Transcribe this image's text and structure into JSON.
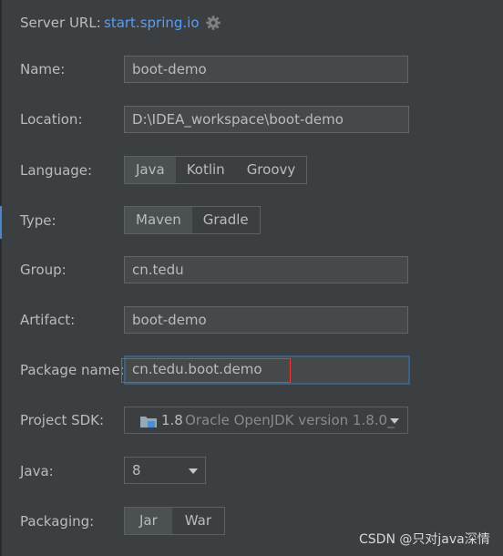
{
  "server": {
    "label": "Server URL:",
    "url": "start.spring.io",
    "settings_icon": "gear-icon"
  },
  "name": {
    "label": "Name:",
    "value": "boot-demo"
  },
  "location": {
    "label": "Location:",
    "value": "D:\\IDEA_workspace\\boot-demo"
  },
  "language": {
    "label": "Language:",
    "options": [
      "Java",
      "Kotlin",
      "Groovy"
    ],
    "selected": "Java"
  },
  "type": {
    "label": "Type:",
    "options": [
      "Maven",
      "Gradle"
    ],
    "selected": "Maven"
  },
  "group": {
    "label": "Group:",
    "value": "cn.tedu"
  },
  "artifact": {
    "label": "Artifact:",
    "value": "boot-demo"
  },
  "package_name": {
    "label": "Package name:",
    "value": "cn.tedu.boot.demo",
    "highlight_color": "#e53935"
  },
  "project_sdk": {
    "label": "Project SDK:",
    "version": "1.8",
    "description": "Oracle OpenJDK version 1.8.0_",
    "icon": "folder-icon"
  },
  "java": {
    "label": "Java:",
    "value": "8"
  },
  "packaging": {
    "label": "Packaging:",
    "options": [
      "Jar",
      "War"
    ],
    "selected": "Jar"
  },
  "watermark": "CSDN @只对java深情",
  "colors": {
    "background": "#3c3f41",
    "field_background": "#45494a",
    "link": "#589df6",
    "selected_segment": "#4b5052",
    "focus_border": "#3d6185"
  }
}
